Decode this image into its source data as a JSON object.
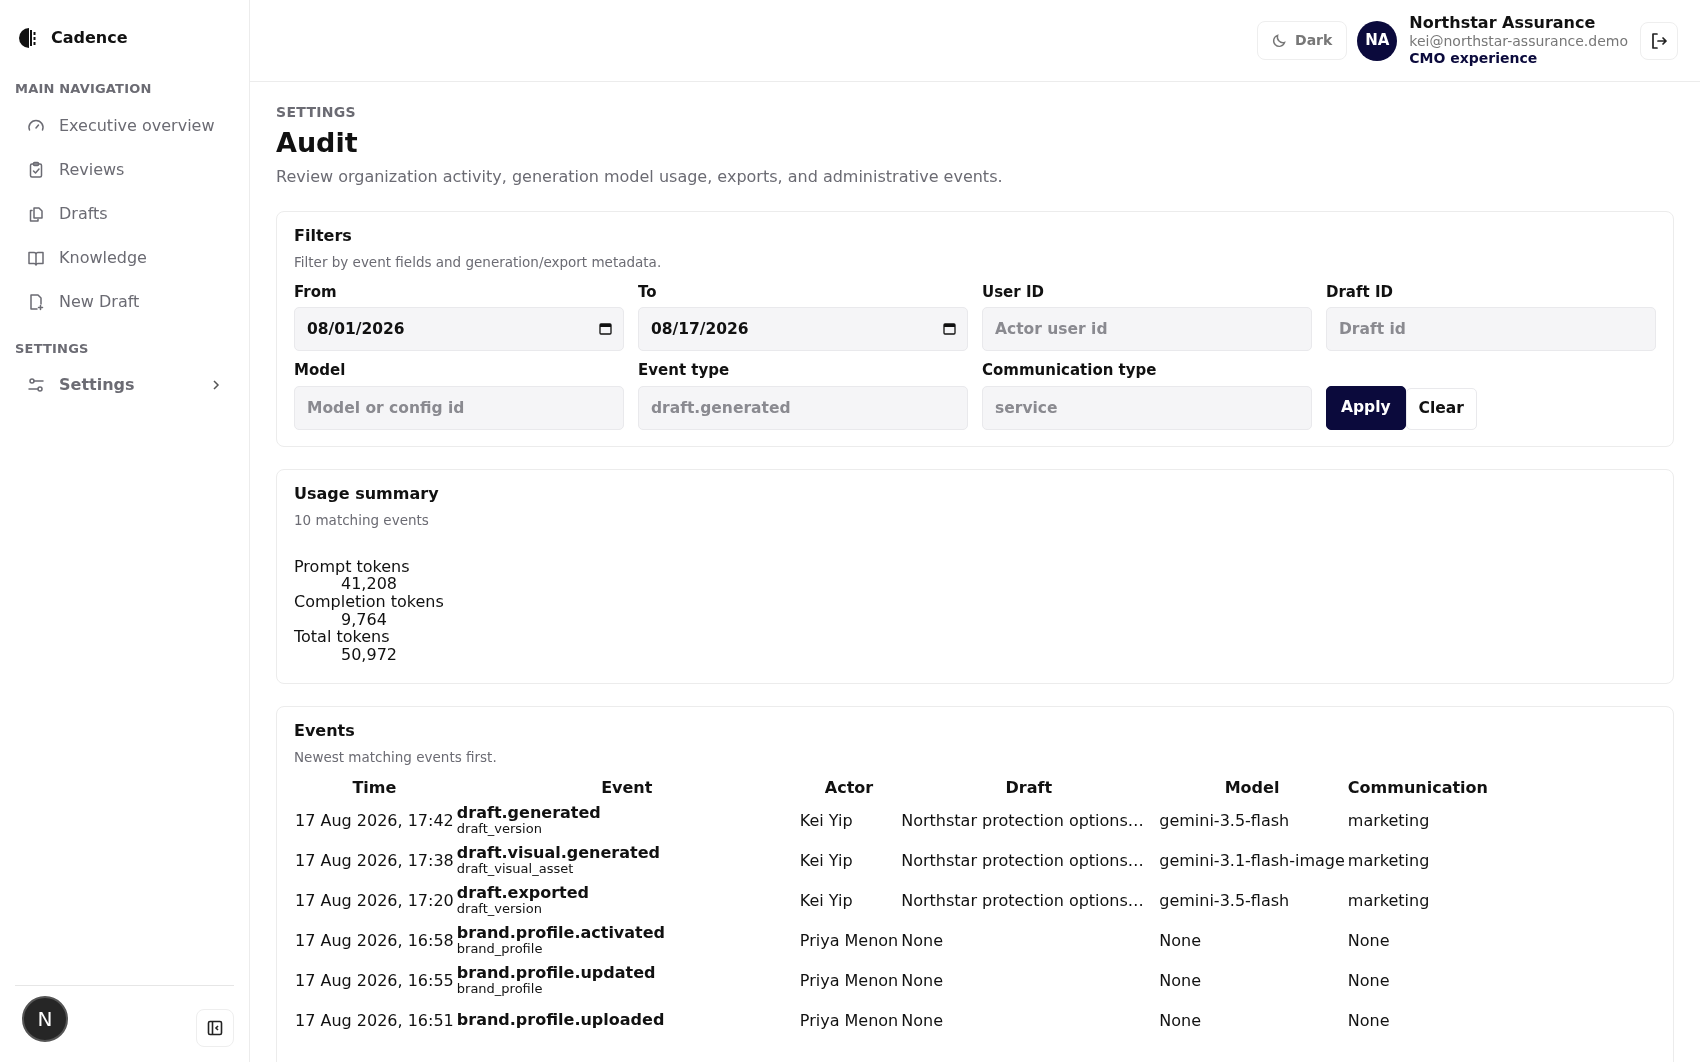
{
  "app": {
    "name": "Cadence"
  },
  "sidebar": {
    "sections": [
      {
        "title": "MAIN NAVIGATION",
        "items": [
          {
            "label": "Executive overview",
            "selected": false
          },
          {
            "label": "Reviews",
            "selected": false
          },
          {
            "label": "Drafts",
            "selected": false
          },
          {
            "label": "Knowledge",
            "selected": false
          },
          {
            "label": "New Draft",
            "selected": false
          }
        ]
      },
      {
        "title": "SETTINGS",
        "items": [
          {
            "label": "Settings",
            "selected": true,
            "expanded": false
          }
        ]
      }
    ],
    "dev_badge": "N"
  },
  "header": {
    "theme_button": "Dark",
    "user": {
      "initials": "NA",
      "name": "Northstar Assurance",
      "email": "kei@northstar-assurance.demo",
      "role": "CMO experience"
    }
  },
  "page": {
    "eyebrow": "SETTINGS",
    "title": "Audit",
    "description": "Review organization activity, generation model usage, exports, and administrative events."
  },
  "filters": {
    "title": "Filters",
    "subtitle": "Filter by event fields and generation/export metadata.",
    "fields": [
      {
        "kind": "date",
        "label": "From",
        "value": "08/01/2026"
      },
      {
        "kind": "date",
        "label": "To",
        "value": "08/17/2026"
      },
      {
        "kind": "text",
        "label": "User ID",
        "placeholder": "Actor user id"
      },
      {
        "kind": "text",
        "label": "Draft ID",
        "placeholder": "Draft id"
      },
      {
        "kind": "text",
        "label": "Model",
        "placeholder": "Model or config id"
      },
      {
        "kind": "text",
        "label": "Event type",
        "placeholder": "draft.generated"
      },
      {
        "kind": "text",
        "label": "Communication type",
        "placeholder": "service"
      }
    ],
    "buttons": [
      {
        "label": "Apply",
        "kind": "primary"
      },
      {
        "label": "Clear",
        "kind": "secondary"
      }
    ]
  },
  "usage": {
    "title": "Usage summary",
    "subtitle": "10 matching events",
    "metrics": [
      {
        "label": "Prompt tokens",
        "value": "41,208"
      },
      {
        "label": "Completion tokens",
        "value": "9,764"
      },
      {
        "label": "Total tokens",
        "value": "50,972"
      }
    ]
  },
  "events": {
    "title": "Events",
    "subtitle": "Newest matching events first.",
    "columns": [
      "Time",
      "Event",
      "Actor",
      "Draft",
      "Model",
      "Communication"
    ],
    "rows": [
      {
        "time": "17 Aug 2026, 17:42",
        "event": "draft.generated",
        "entity": "draft_version",
        "actor": "Kei Yip",
        "draft": "Northstar protection options…",
        "model": "gemini-3.5-flash",
        "communication": "marketing"
      },
      {
        "time": "17 Aug 2026, 17:38",
        "event": "draft.visual.generated",
        "entity": "draft_visual_asset",
        "actor": "Kei Yip",
        "draft": "Northstar protection options…",
        "model": "gemini-3.1-flash-image",
        "communication": "marketing"
      },
      {
        "time": "17 Aug 2026, 17:20",
        "event": "draft.exported",
        "entity": "draft_version",
        "actor": "Kei Yip",
        "draft": "Northstar protection options…",
        "model": "gemini-3.5-flash",
        "communication": "marketing"
      },
      {
        "time": "17 Aug 2026, 16:58",
        "event": "brand.profile.activated",
        "entity": "brand_profile",
        "actor": "Priya Menon",
        "draft": "None",
        "model": "None",
        "communication": "None"
      },
      {
        "time": "17 Aug 2026, 16:55",
        "event": "brand.profile.updated",
        "entity": "brand_profile",
        "actor": "Priya Menon",
        "draft": "None",
        "model": "None",
        "communication": "None"
      },
      {
        "time": "17 Aug 2026, 16:51",
        "event": "brand.profile.uploaded",
        "actor": "Priya Menon",
        "draft": "None",
        "model": "None",
        "communication": "None"
      }
    ]
  }
}
